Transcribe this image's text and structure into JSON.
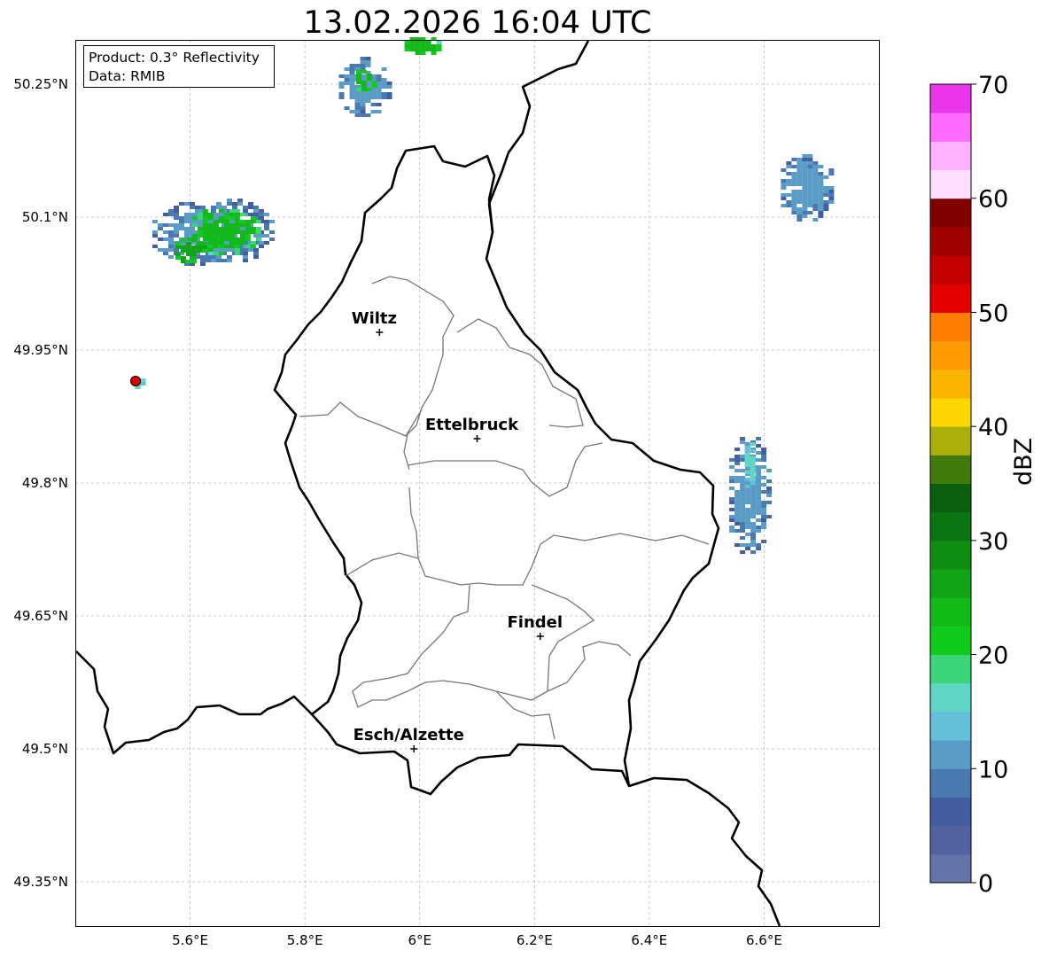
{
  "title": "13.02.2026 16:04 UTC",
  "info_box": {
    "product": "Product: 0.3° Reflectivity",
    "data": "Data: RMIB"
  },
  "lat_ticks": [
    {
      "lat": 50.25,
      "label": "50.25°N"
    },
    {
      "lat": 50.1,
      "label": "50.1°N"
    },
    {
      "lat": 49.95,
      "label": "49.95°N"
    },
    {
      "lat": 49.8,
      "label": "49.8°N"
    },
    {
      "lat": 49.65,
      "label": "49.65°N"
    },
    {
      "lat": 49.5,
      "label": "49.5°N"
    },
    {
      "lat": 49.35,
      "label": "49.35°N"
    }
  ],
  "lon_ticks": [
    {
      "lon": 5.6,
      "label": "5.6°E"
    },
    {
      "lon": 5.8,
      "label": "5.8°E"
    },
    {
      "lon": 6.0,
      "label": "6°E"
    },
    {
      "lon": 6.2,
      "label": "6.2°E"
    },
    {
      "lon": 6.4,
      "label": "6.4°E"
    },
    {
      "lon": 6.6,
      "label": "6.6°E"
    }
  ],
  "extent": {
    "lon_min": 5.4,
    "lon_max": 6.8,
    "lat_min": 49.3,
    "lat_max": 50.3
  },
  "cities": [
    {
      "name": "Wiltz",
      "lon": 5.93,
      "lat": 49.97
    },
    {
      "name": "Ettelbruck",
      "lon": 6.1,
      "lat": 49.85
    },
    {
      "name": "Findel",
      "lon": 6.21,
      "lat": 49.627
    },
    {
      "name": "Esch/Alzette",
      "lon": 5.99,
      "lat": 49.5
    }
  ],
  "radar_site": {
    "lon": 5.505,
    "lat": 49.915,
    "color": "#e00000"
  },
  "colorbar": {
    "unit": "dBZ",
    "min": 0,
    "max": 70,
    "tick_values": [
      0,
      10,
      20,
      30,
      40,
      50,
      60,
      70
    ],
    "tick_labels": [
      "0",
      "10",
      "20",
      "30",
      "40",
      "50",
      "60",
      "70"
    ],
    "colors": [
      "#6574a8",
      "#5063a0",
      "#435da0",
      "#4a79b0",
      "#5a9cc6",
      "#65bfd9",
      "#60d6c6",
      "#3dd57a",
      "#10ca1e",
      "#12ba17",
      "#11a418",
      "#0f8d13",
      "#0a7512",
      "#0a5e0e",
      "#427a0d",
      "#abb10a",
      "#ffd700",
      "#fbb500",
      "#ff9b00",
      "#ff7d00",
      "#e20000",
      "#c20000",
      "#a00000",
      "#800000",
      "#ffdeff",
      "#ffb2ff",
      "#ff6bff",
      "#ea36ea"
    ]
  },
  "radar_cells": [
    {
      "lon": 5.635,
      "lat": 50.085,
      "rlon": 0.11,
      "rlat": 0.04,
      "level": 4
    },
    {
      "lon": 5.655,
      "lat": 50.085,
      "rlon": 0.07,
      "rlat": 0.028,
      "level": 9
    },
    {
      "lon": 5.595,
      "lat": 50.065,
      "rlon": 0.03,
      "rlat": 0.015,
      "level": 10
    },
    {
      "lon": 5.9,
      "lat": 50.25,
      "rlon": 0.05,
      "rlat": 0.035,
      "level": 4
    },
    {
      "lon": 5.9,
      "lat": 50.255,
      "rlon": 0.02,
      "rlat": 0.015,
      "level": 9
    },
    {
      "lon": 5.995,
      "lat": 50.295,
      "rlon": 0.04,
      "rlat": 0.012,
      "level": 9
    },
    {
      "lon": 6.67,
      "lat": 50.135,
      "rlon": 0.05,
      "rlat": 0.04,
      "level": 4
    },
    {
      "lon": 6.57,
      "lat": 49.79,
      "rlon": 0.04,
      "rlat": 0.07,
      "level": 4
    },
    {
      "lon": 6.57,
      "lat": 49.82,
      "rlon": 0.013,
      "rlat": 0.03,
      "level": 6
    },
    {
      "lon": 5.505,
      "lat": 49.915,
      "rlon": 0.01,
      "rlat": 0.007,
      "level": 7
    }
  ]
}
